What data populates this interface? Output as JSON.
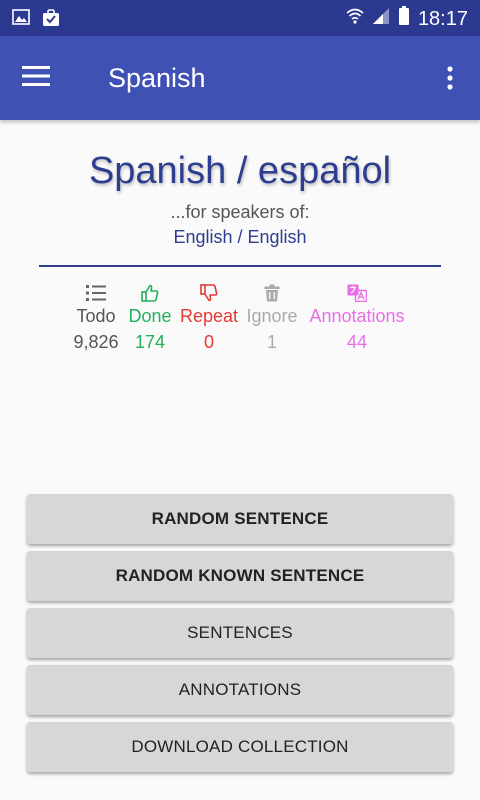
{
  "status_bar": {
    "time": "18:17",
    "left_icons": [
      "image-icon",
      "shopping-bag-check-icon"
    ],
    "right_icons": [
      "wifi-icon",
      "cell-signal-icon",
      "battery-icon"
    ]
  },
  "app_bar": {
    "title": "Spanish",
    "menu_icon": "hamburger-menu-icon",
    "overflow_icon": "more-vert-icon",
    "color": "#3f51b5"
  },
  "header": {
    "language_title": "Spanish / español",
    "speakers_label": "...for speakers of:",
    "speakers_language": "English / English"
  },
  "stats": {
    "todo": {
      "label": "Todo",
      "value": "9,826",
      "icon": "numbered-list-icon",
      "color": "#555555"
    },
    "done": {
      "label": "Done",
      "value": "174",
      "icon": "thumbs-up-icon",
      "color": "#21b15a"
    },
    "repeat": {
      "label": "Repeat",
      "value": "0",
      "icon": "thumbs-down-icon",
      "color": "#e53935"
    },
    "ignore": {
      "label": "Ignore",
      "value": "1",
      "icon": "trash-icon",
      "color": "#aaaaaa"
    },
    "annotations": {
      "label": "Annotations",
      "value": "44",
      "icon": "translate-icon",
      "color": "#e86ee8"
    }
  },
  "buttons": {
    "random_sentence": "Random Sentence",
    "random_known_sentence": "Random Known Sentence",
    "sentences": "Sentences",
    "annotations": "Annotations",
    "download_collection": "Download Collection"
  }
}
